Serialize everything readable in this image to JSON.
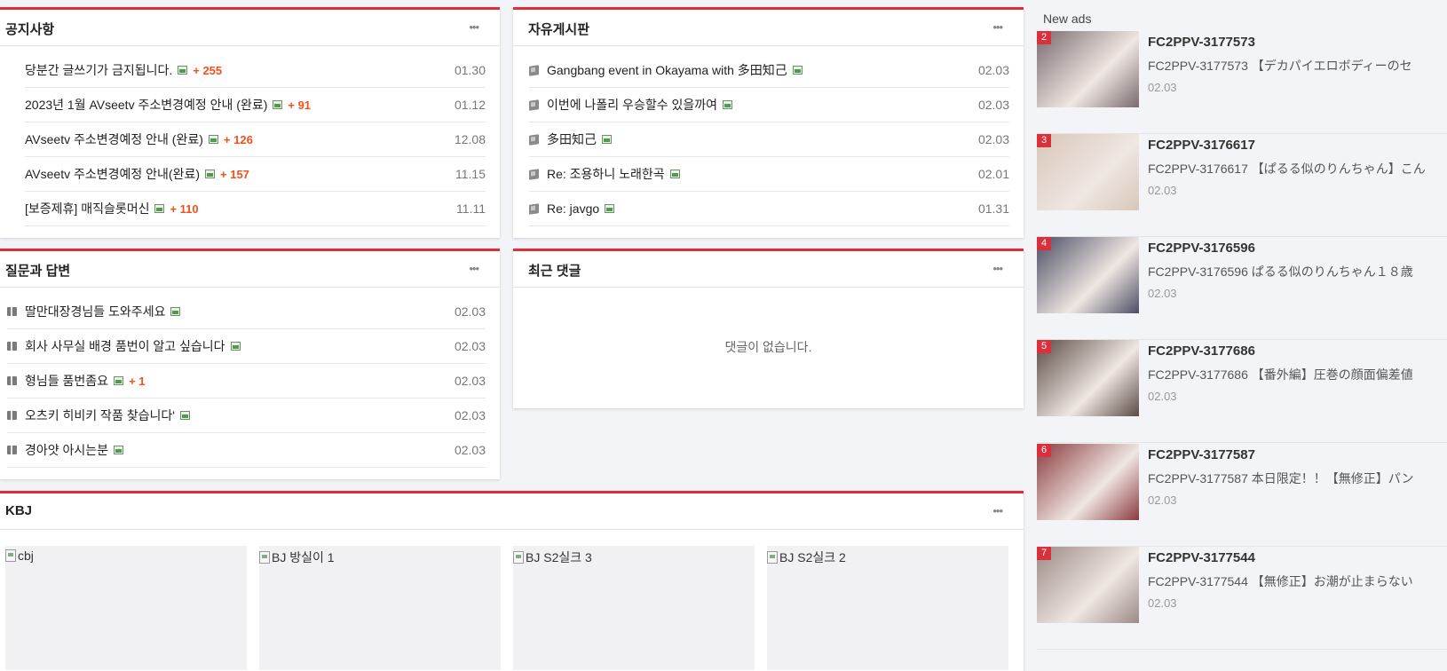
{
  "notice": {
    "title": "공지사항",
    "rows": [
      {
        "title": "당분간 글쓰기가 금지됩니다.",
        "count": "+ 255",
        "date": "01.30"
      },
      {
        "title": "2023년 1월 AVseetv 주소변경예정 안내 (완료)",
        "count": "+ 91",
        "date": "01.12"
      },
      {
        "title": "AVseetv 주소변경예정 안내 (완료)",
        "count": "+ 126",
        "date": "12.08"
      },
      {
        "title": "AVseetv 주소변경예정 안내(완료)",
        "count": "+ 157",
        "date": "11.15"
      },
      {
        "title": "[보증제휴] 매직슬롯머신",
        "count": "+ 110",
        "date": "11.11"
      }
    ]
  },
  "free_board": {
    "title": "자유게시판",
    "rows": [
      {
        "title": "Gangbang event in Okayama with 多田知己",
        "date": "02.03"
      },
      {
        "title": "이번에 나폴리 우승할수 있을까여",
        "date": "02.03"
      },
      {
        "title": "多田知己",
        "date": "02.03"
      },
      {
        "title": "Re: 조용하니 노래한곡",
        "date": "02.01"
      },
      {
        "title": "Re: javgo",
        "date": "01.31"
      }
    ]
  },
  "qna": {
    "title": "질문과 답변",
    "rows": [
      {
        "title": "딸만대장경님들 도와주세요",
        "count": "",
        "date": "02.03"
      },
      {
        "title": "회사 사무실 배경 품번이 알고 싶습니다",
        "count": "",
        "date": "02.03"
      },
      {
        "title": "형님들 품번좀요",
        "count": "+ 1",
        "date": "02.03"
      },
      {
        "title": "오츠키 히비키 작품 찾습니다'",
        "count": "",
        "date": "02.03"
      },
      {
        "title": "경아얏 아시는분",
        "count": "",
        "date": "02.03"
      }
    ]
  },
  "recent_comments": {
    "title": "최근 댓글",
    "empty_text": "댓글이 없습니다."
  },
  "kbj": {
    "title": "KBJ",
    "cards": [
      {
        "alt": "cbj"
      },
      {
        "alt": "BJ 방실이 1"
      },
      {
        "alt": "BJ S2실크 3"
      },
      {
        "alt": "BJ S2실크 2"
      }
    ]
  },
  "sidebar": {
    "title": "New ads",
    "ads": [
      {
        "rank": "2",
        "title": "FC2PPV-3177573",
        "desc": "FC2PPV-3177573 【デカパイエロボディーのセ",
        "date": "02.03",
        "thumb_color": "#7a6a6e"
      },
      {
        "rank": "3",
        "title": "FC2PPV-3176617",
        "desc": "FC2PPV-3176617 【ぱるる似のりんちゃん】こん",
        "date": "02.03",
        "thumb_color": "#d9c6b8"
      },
      {
        "rank": "4",
        "title": "FC2PPV-3176596",
        "desc": "FC2PPV-3176596 ぱるる似のりんちゃん１８歳",
        "date": "02.03",
        "thumb_color": "#4b4d63"
      },
      {
        "rank": "5",
        "title": "FC2PPV-3177686",
        "desc": "FC2PPV-3177686 【番外編】圧巻の顔面偏差値",
        "date": "02.03",
        "thumb_color": "#5b4a45"
      },
      {
        "rank": "6",
        "title": "FC2PPV-3177587",
        "desc": "FC2PPV-3177587 本日限定！！【無修正】パン",
        "date": "02.03",
        "thumb_color": "#8a3a3e"
      },
      {
        "rank": "7",
        "title": "FC2PPV-3177544",
        "desc": "FC2PPV-3177544 【無修正】お潮が止まらない",
        "date": "02.03",
        "thumb_color": "#9c8a86"
      }
    ]
  }
}
